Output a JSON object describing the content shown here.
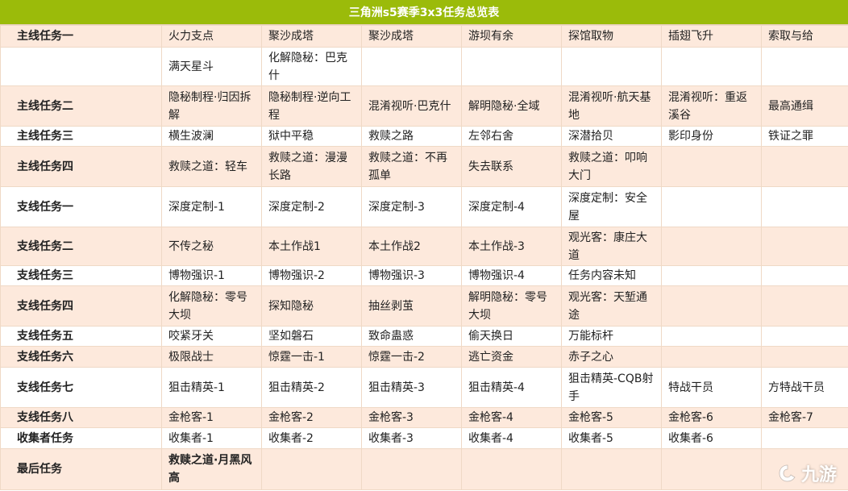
{
  "title": "三角洲s5赛季3x3任务总览表",
  "colors": {
    "title_bg": "#9bbb0a",
    "peach": "#fde9dc",
    "red": "#d23c2c",
    "link": "#3a8fd0"
  },
  "rows": [
    {
      "label": "主线任务一",
      "label_style": "red",
      "bg": "peach",
      "height": 27,
      "cells": [
        {
          "t": "火力支点",
          "s": "plain"
        },
        {
          "t": "聚沙成塔",
          "s": "plain"
        },
        {
          "t": "聚沙成塔",
          "s": "plain"
        },
        {
          "t": "游坝有余",
          "s": "plain"
        },
        {
          "t": "探馆取物",
          "s": "plain"
        },
        {
          "t": "插翅飞升",
          "s": "plain"
        },
        {
          "t": "索取与给",
          "s": "plain"
        }
      ]
    },
    {
      "label": "",
      "label_style": "red",
      "bg": "white",
      "height": 48,
      "cells": [
        {
          "t": "满天星斗",
          "s": "link"
        },
        {
          "t": "化解隐秘：巴克什",
          "s": "link"
        },
        {
          "t": "",
          "s": "plain"
        },
        {
          "t": "",
          "s": "plain"
        },
        {
          "t": "",
          "s": "plain"
        },
        {
          "t": "",
          "s": "plain"
        },
        {
          "t": "",
          "s": "plain"
        }
      ]
    },
    {
      "label": "主线任务二",
      "label_style": "red",
      "bg": "peach",
      "height": 50,
      "cells": [
        {
          "t": "隐秘制程·归因拆解",
          "s": "link"
        },
        {
          "t": "隐秘制程·逆向工程",
          "s": "plain"
        },
        {
          "t": "混淆视听·巴克什",
          "s": "link"
        },
        {
          "t": "解明隐秘·全域",
          "s": "plain"
        },
        {
          "t": "混淆视听·航天基地",
          "s": "link"
        },
        {
          "t": "混淆视听：重返溪谷",
          "s": "link"
        },
        {
          "t": "最高通缉",
          "s": "link"
        }
      ]
    },
    {
      "label": "主线任务三",
      "label_style": "red",
      "bg": "white",
      "height": 25,
      "cells": [
        {
          "t": "横生波澜",
          "s": "plain"
        },
        {
          "t": "狱中平稳",
          "s": "plain"
        },
        {
          "t": "救赎之路",
          "s": "plain"
        },
        {
          "t": "左邻右舍",
          "s": "plain"
        },
        {
          "t": "深潜拾贝",
          "s": "plain"
        },
        {
          "t": "影印身份",
          "s": "plain"
        },
        {
          "t": "铁证之罪",
          "s": "plain"
        }
      ]
    },
    {
      "label": "主线任务四",
      "label_style": "dark",
      "bg": "peach",
      "height": 50,
      "cells": [
        {
          "t": "救赎之道：轻车",
          "s": "plain"
        },
        {
          "t": "救赎之道：漫漫长路",
          "s": "link"
        },
        {
          "t": "救赎之道：不再孤单",
          "s": "plain"
        },
        {
          "t": "失去联系",
          "s": "link"
        },
        {
          "t": "救赎之道：叩响大门",
          "s": "link"
        },
        {
          "t": "",
          "s": "plain"
        },
        {
          "t": "",
          "s": "plain"
        }
      ]
    },
    {
      "label": "支线任务一",
      "label_style": "dark",
      "bg": "white",
      "height": 50,
      "cells": [
        {
          "t": "深度定制-1",
          "s": "plain"
        },
        {
          "t": "深度定制-2",
          "s": "plain"
        },
        {
          "t": "深度定制-3",
          "s": "plain"
        },
        {
          "t": "深度定制-4",
          "s": "plain"
        },
        {
          "t": "深度定制：安全屋",
          "s": "plain"
        },
        {
          "t": "",
          "s": "plain"
        },
        {
          "t": "",
          "s": "plain"
        }
      ]
    },
    {
      "label": "支线任务二",
      "label_style": "dark",
      "bg": "peach",
      "height": 48,
      "cells": [
        {
          "t": "不传之秘",
          "s": "plain"
        },
        {
          "t": "本土作战1",
          "s": "plain"
        },
        {
          "t": "本土作战2",
          "s": "plain"
        },
        {
          "t": "本土作战-3",
          "s": "plain"
        },
        {
          "t": "观光客：康庄大道",
          "s": "link"
        },
        {
          "t": "",
          "s": "plain"
        },
        {
          "t": "",
          "s": "plain"
        }
      ]
    },
    {
      "label": "支线任务三",
      "label_style": "dark",
      "bg": "white",
      "height": 25,
      "cells": [
        {
          "t": "博物强识-1",
          "s": "plain"
        },
        {
          "t": "博物强识-2",
          "s": "plain"
        },
        {
          "t": "博物强识-3",
          "s": "plain"
        },
        {
          "t": "博物强识-4",
          "s": "plain"
        },
        {
          "t": "任务内容未知",
          "s": "plain"
        },
        {
          "t": "",
          "s": "plain"
        },
        {
          "t": "",
          "s": "plain"
        }
      ]
    },
    {
      "label": "支线任务四",
      "label_style": "dark",
      "bg": "peach",
      "height": 50,
      "cells": [
        {
          "t": "化解隐秘：零号大坝",
          "s": "link"
        },
        {
          "t": "探知隐秘",
          "s": "link"
        },
        {
          "t": "抽丝剥茧",
          "s": "plain"
        },
        {
          "t": "解明隐秘：零号大坝",
          "s": "plain"
        },
        {
          "t": "观光客：天堑通途",
          "s": "link"
        },
        {
          "t": "",
          "s": "plain"
        },
        {
          "t": "",
          "s": "plain"
        }
      ]
    },
    {
      "label": "支线任务五",
      "label_style": "dark",
      "bg": "white",
      "height": 25,
      "cells": [
        {
          "t": "咬紧牙关",
          "s": "plain"
        },
        {
          "t": "坚如磐石",
          "s": "plain"
        },
        {
          "t": "致命蛊惑",
          "s": "plain"
        },
        {
          "t": "偷天换日",
          "s": "plain"
        },
        {
          "t": "万能标杆",
          "s": "link"
        },
        {
          "t": "",
          "s": "plain"
        },
        {
          "t": "",
          "s": "plain"
        }
      ]
    },
    {
      "label": "支线任务六",
      "label_style": "dark",
      "bg": "peach",
      "height": 26,
      "cells": [
        {
          "t": "极限战士",
          "s": "plain"
        },
        {
          "t": "惊霆一击-1",
          "s": "plain"
        },
        {
          "t": "惊霆一击-2",
          "s": "plain"
        },
        {
          "t": "逃亡资金",
          "s": "plain"
        },
        {
          "t": "赤子之心",
          "s": "plain"
        },
        {
          "t": "",
          "s": "plain"
        },
        {
          "t": "",
          "s": "plain"
        }
      ]
    },
    {
      "label": "支线任务七",
      "label_style": "dark",
      "bg": "white",
      "height": 50,
      "cells": [
        {
          "t": "狙击精英-1",
          "s": "plain"
        },
        {
          "t": "狙击精英-2",
          "s": "plain"
        },
        {
          "t": "狙击精英-3",
          "s": "plain"
        },
        {
          "t": "狙击精英-4",
          "s": "plain"
        },
        {
          "t": "狙击精英-CQB射手",
          "s": "link"
        },
        {
          "t": "特战干员",
          "s": "plain"
        },
        {
          "t": "方特战干员",
          "s": "plain"
        }
      ]
    },
    {
      "label": "支线任务八",
      "label_style": "dark",
      "bg": "peach",
      "height": 25,
      "cells": [
        {
          "t": "金枪客-1",
          "s": "plain"
        },
        {
          "t": "金枪客-2",
          "s": "plain"
        },
        {
          "t": "金枪客-3",
          "s": "plain"
        },
        {
          "t": "金枪客-4",
          "s": "plain"
        },
        {
          "t": "金枪客-5",
          "s": "plain"
        },
        {
          "t": "金枪客-6",
          "s": "plain"
        },
        {
          "t": "金枪客-7",
          "s": "link"
        }
      ]
    },
    {
      "label": "收集者任务",
      "label_style": "red",
      "bg": "white",
      "height": 26,
      "cells": [
        {
          "t": "收集者-1",
          "s": "plain"
        },
        {
          "t": "收集者-2",
          "s": "plain"
        },
        {
          "t": "收集者-3",
          "s": "plain"
        },
        {
          "t": "收集者-4",
          "s": "plain"
        },
        {
          "t": "收集者-5",
          "s": "plain"
        },
        {
          "t": "收集者-6",
          "s": "plain"
        },
        {
          "t": "",
          "s": "plain"
        }
      ]
    },
    {
      "label": "最后任务",
      "label_style": "red",
      "bg": "peach",
      "height": 51,
      "cells": [
        {
          "t": "救赎之道·月黑风高",
          "s": "link-bold"
        },
        {
          "t": "",
          "s": "plain"
        },
        {
          "t": "",
          "s": "plain"
        },
        {
          "t": "",
          "s": "plain"
        },
        {
          "t": "",
          "s": "plain"
        },
        {
          "t": "",
          "s": "plain"
        },
        {
          "t": "",
          "s": "plain"
        }
      ]
    }
  ],
  "watermark": {
    "text": "九游",
    "icon": "jiuyou-logo-icon"
  }
}
